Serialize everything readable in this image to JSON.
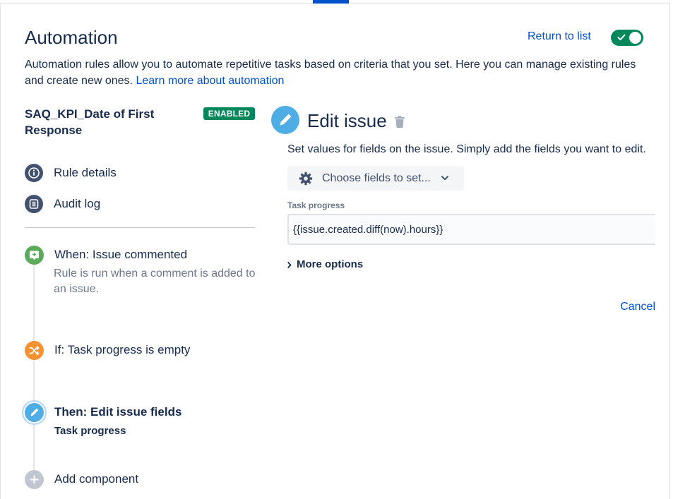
{
  "page": {
    "title": "Automation",
    "return_link": "Return to list",
    "rule_toggle": {
      "enabled": true
    }
  },
  "intro": {
    "text": "Automation rules allow you to automate repetitive tasks based on criteria that you set. Here you can manage existing rules and create new ones.",
    "link": "Learn more about automation"
  },
  "rule": {
    "name": "SAQ_KPI_Date of First Response",
    "status": "ENABLED"
  },
  "rule_nav": [
    {
      "label": "Rule details",
      "icon": "info-icon"
    },
    {
      "label": "Audit log",
      "icon": "list-icon"
    }
  ],
  "components": [
    {
      "label": "When: Issue commented",
      "description": "Rule is run when a comment is added to an issue.",
      "icon": "comment-plus-icon",
      "color": "#5aac5a",
      "selected": false
    },
    {
      "label": "If: Task progress is empty",
      "icon": "shuffle-icon",
      "color": "#f79232",
      "selected": false
    },
    {
      "label": "Then: Edit issue fields",
      "detail": "Task progress",
      "icon": "pencil-icon",
      "color": "#4fade6",
      "selected": true
    },
    {
      "label": "Add component",
      "icon": "plus-icon",
      "color": "#c1c7d0",
      "selected": false
    }
  ],
  "editor": {
    "icon": "pencil-icon",
    "icon_color": "#4fade6",
    "title": "Edit issue",
    "description": "Set values for fields on the issue. Simply add the fields you want to edit.",
    "choose_fields": "Choose fields to set...",
    "field_label": "Task progress",
    "field_value": "{{issue.created.diff(now).hours}}",
    "more_options": "More options",
    "cancel": "Cancel"
  },
  "theme": {
    "link_color": "#0052cc",
    "status_green": "#00875a",
    "text_color": "#172b4d",
    "subtle_text": "#6b778c"
  }
}
